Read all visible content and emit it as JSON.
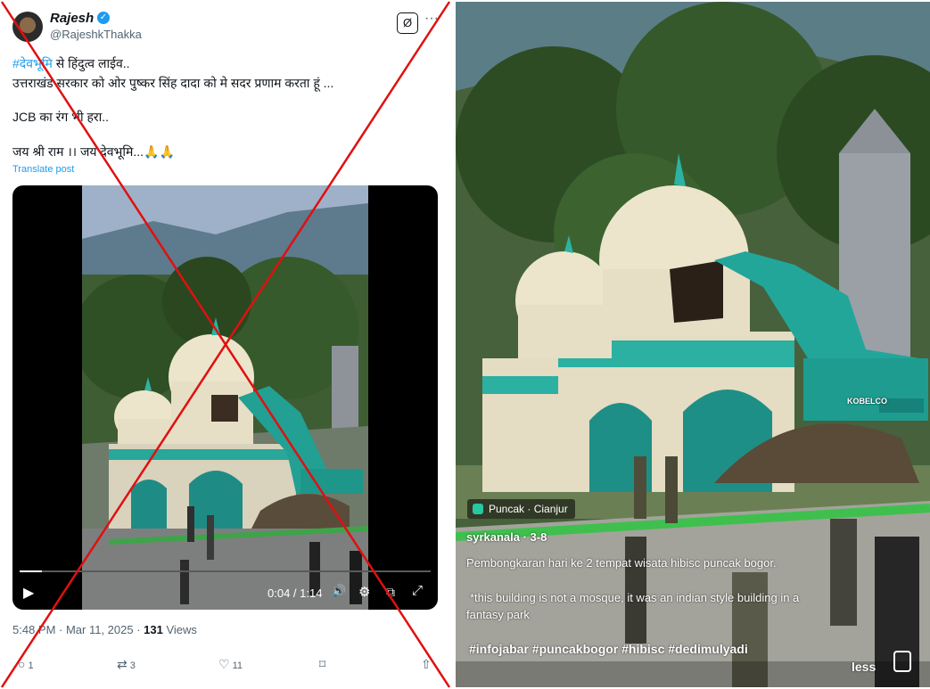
{
  "tweet": {
    "display_name": "Rajesh",
    "verified_icon": "✓",
    "handle": "@RajeshkThakka",
    "grok_icon": "Ø",
    "more_icon": "···",
    "hashtag": "#देवभूमि",
    "line1_rest": " से हिंदुत्व लाईव..",
    "line2": "उत्तराखंड सरकार को ओर पुष्कर सिंह दादा को मे सदर  प्रणाम करता हूं ...",
    "line3": "JCB का रंग भी हरा..",
    "line4": "जय श्री राम ।। जय देवभूमि...🙏🙏",
    "translate_label": "Translate post",
    "video": {
      "time": "0:04 / 1:14",
      "progress": 0.054,
      "play_icon": "▶",
      "volume_icon": "🔊",
      "settings_icon": "⚙",
      "pip_icon": "⧉",
      "fullscreen_icon": "⤢"
    },
    "meta": {
      "timestamp": "5:48 PM · Mar 11, 2025 · ",
      "views_count": "131",
      "views_label": " Views"
    },
    "actions": {
      "reply_count": "1",
      "retweet_count": "3",
      "like_count": "11",
      "reply_icon": "○",
      "retweet_icon": "⇄",
      "like_icon": "♡",
      "bookmark_icon": "⌑",
      "share_icon": "⇧"
    }
  },
  "tiktok": {
    "location": "Puncak · Cianjur",
    "username": "syrkanala · 3-8",
    "caption": "Pembongkaran hari ke 2 tempat wisata hibisc puncak bogor.",
    "note_line1": "*this building is not a mosque, it was an indian style building in a",
    "note_line2": "fantasy park",
    "hashtags": "#infojabar  #puncakbogor  #hibisc  #dedimulyadi",
    "less_label": "less",
    "excavator_brand": "KOBELCO"
  },
  "overlay": {
    "cross_color": "#e01010"
  }
}
